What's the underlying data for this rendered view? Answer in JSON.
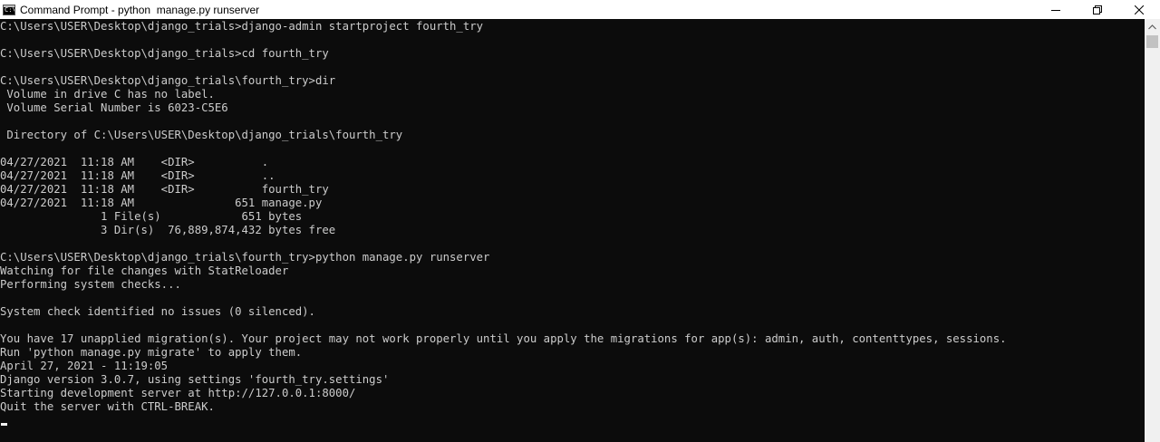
{
  "window": {
    "title": "Command Prompt - python  manage.py runserver",
    "icon_label": "C:\\"
  },
  "controls": {
    "minimize": "minimize-icon",
    "maximize": "restore-icon",
    "close": "close-icon"
  },
  "console": {
    "lines": [
      "C:\\Users\\USER\\Desktop\\django_trials>django-admin startproject fourth_try",
      "",
      "C:\\Users\\USER\\Desktop\\django_trials>cd fourth_try",
      "",
      "C:\\Users\\USER\\Desktop\\django_trials\\fourth_try>dir",
      " Volume in drive C has no label.",
      " Volume Serial Number is 6023-C5E6",
      "",
      " Directory of C:\\Users\\USER\\Desktop\\django_trials\\fourth_try",
      "",
      "04/27/2021  11:18 AM    <DIR>          .",
      "04/27/2021  11:18 AM    <DIR>          ..",
      "04/27/2021  11:18 AM    <DIR>          fourth_try",
      "04/27/2021  11:18 AM               651 manage.py",
      "               1 File(s)            651 bytes",
      "               3 Dir(s)  76,889,874,432 bytes free",
      "",
      "C:\\Users\\USER\\Desktop\\django_trials\\fourth_try>python manage.py runserver",
      "Watching for file changes with StatReloader",
      "Performing system checks...",
      "",
      "System check identified no issues (0 silenced).",
      "",
      "You have 17 unapplied migration(s). Your project may not work properly until you apply the migrations for app(s): admin, auth, contenttypes, sessions.",
      "Run 'python manage.py migrate' to apply them.",
      "April 27, 2021 - 11:19:05",
      "Django version 3.0.7, using settings 'fourth_try.settings'",
      "Starting development server at http://127.0.0.1:8000/",
      "Quit the server with CTRL-BREAK."
    ]
  },
  "colors": {
    "background": "#0c0c0c",
    "text": "#cccccc",
    "titlebar": "#ffffff",
    "scrollbar_track": "#f0f0f0",
    "scrollbar_thumb": "#c2c2c2"
  }
}
